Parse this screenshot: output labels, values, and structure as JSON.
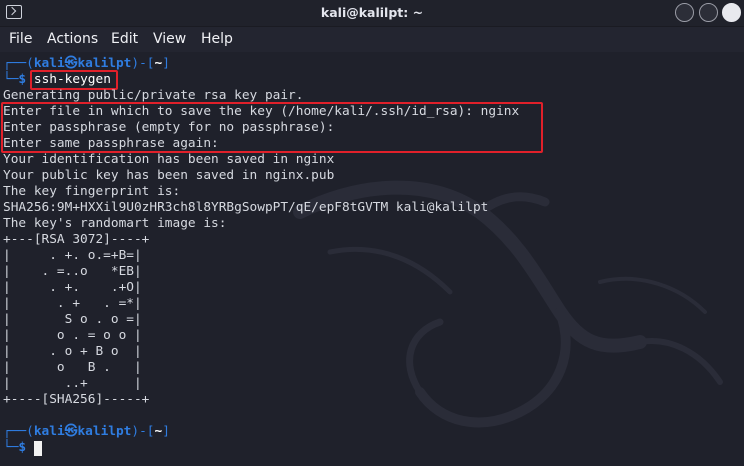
{
  "window": {
    "title": "kali@kalilpt: ~"
  },
  "menu": [
    "File",
    "Actions",
    "Edit",
    "View",
    "Help"
  ],
  "prompt": {
    "top_prefix": "┌──(",
    "user": "kali",
    "at": "㉿",
    "host": "kalilpt",
    "mid": ")-[",
    "dir": "~",
    "end": "]",
    "bottom_prefix": "└─",
    "symbol": "$"
  },
  "command": "ssh-keygen",
  "output": [
    "Generating public/private rsa key pair.",
    "Enter file in which to save the key (/home/kali/.ssh/id_rsa): nginx",
    "Enter passphrase (empty for no passphrase):",
    "Enter same passphrase again:",
    "Your identification has been saved in nginx",
    "Your public key has been saved in nginx.pub",
    "The key fingerprint is:",
    "SHA256:9M+HXXil9U0zHR3ch8l8YRBgSowpPT/qE/epF8tGVTM kali@kalilpt",
    "The key's randomart image is:",
    "+---[RSA 3072]----+",
    "|     . +. o.=+B=|",
    "|    . =..o   *EB|",
    "|     . +.    .+O|",
    "|      . +   . =*|",
    "|       S o . o =|",
    "|      o . = o o |",
    "|     . o + B o  |",
    "|      o   B .   |",
    "|       ..+      |",
    "+----[SHA256]-----+"
  ],
  "colors": {
    "prompt_accent": "#2f7de1",
    "highlight_box": "#e0202a",
    "terminal_bg": "#1f212b",
    "text": "#d6d9e0"
  }
}
